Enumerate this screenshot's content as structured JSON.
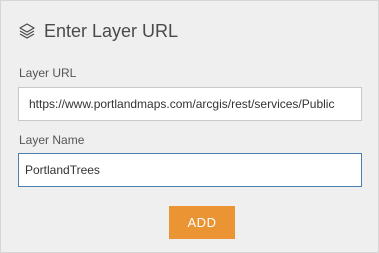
{
  "header": {
    "icon": "layers-icon",
    "title": "Enter Layer URL"
  },
  "form": {
    "layer_url": {
      "label": "Layer URL",
      "value": "https://www.portlandmaps.com/arcgis/rest/services/Public"
    },
    "layer_name": {
      "label": "Layer Name",
      "value": "PortlandTrees"
    }
  },
  "actions": {
    "add_label": "ADD"
  },
  "colors": {
    "panel_background": "#efefef",
    "accent_button": "#ea9434",
    "focused_border": "#4c7fb0"
  }
}
